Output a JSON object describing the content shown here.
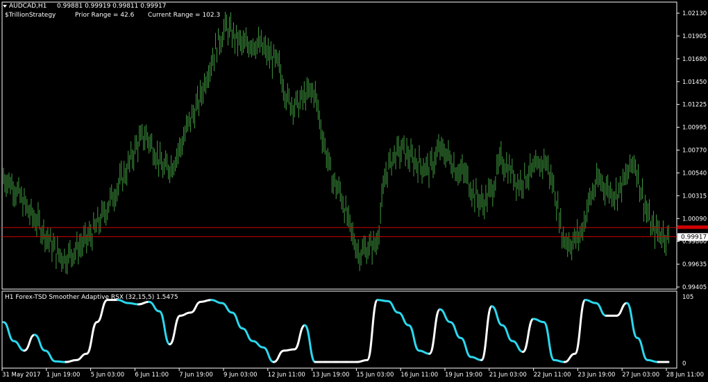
{
  "header": {
    "symbol": "AUDCAD,H1",
    "ohlc": "0.99881 0.99919 0.99811 0.99917",
    "indicator_name": "$TrillionStrategy",
    "prior_range": "Prior Range = 42.6",
    "current_range": "Current Range = 102.3"
  },
  "subwindow": {
    "title": "H1 Forex-TSD Smoother Adaptive RSX (32,15,5) 1.5475",
    "scale_labels": [
      "105",
      "0"
    ],
    "scale_values": [
      105,
      0
    ]
  },
  "price_scale": {
    "labels": [
      "1.02130",
      "1.01905",
      "1.01680",
      "1.01450",
      "1.01225",
      "1.00995",
      "1.00770",
      "1.00540",
      "1.00315",
      "1.00090",
      "0.99860",
      "0.99635",
      "0.99405"
    ],
    "current_price_label": "0.99917",
    "current_price": 0.99917,
    "red_line_price": 1.0001
  },
  "time_axis": {
    "labels": [
      "31 May 2017",
      "1 Jun 19:00",
      "5 Jun 03:00",
      "6 Jun 11:00",
      "7 Jun 19:00",
      "9 Jun 03:00",
      "12 Jun 11:00",
      "13 Jun 19:00",
      "15 Jun 03:00",
      "16 Jun 11:00",
      "19 Jun 19:00",
      "21 Jun 03:00",
      "22 Jun 11:00",
      "23 Jun 19:00",
      "27 Jun 03:00",
      "28 Jun 11:00"
    ]
  },
  "colors": {
    "background": "#000000",
    "candles": "#3f9a3f",
    "grid_border": "#ffffff",
    "red_line": "#d00000",
    "rsx_up": "#ffffff",
    "rsx_down": "#2ad8ee",
    "price_tag_bg": "#ffffff"
  },
  "chart_data": {
    "type": "line",
    "main_window": {
      "kind": "price bars",
      "ylim": [
        0.99405,
        1.0219
      ],
      "close_path": [
        [
          0,
          1.0052
        ],
        [
          5,
          1.0045
        ],
        [
          10,
          1.003
        ],
        [
          15,
          1.0015
        ],
        [
          20,
          1.0005
        ],
        [
          25,
          0.999
        ],
        [
          30,
          0.9975
        ],
        [
          35,
          0.997
        ],
        [
          40,
          0.9978
        ],
        [
          45,
          0.9985
        ],
        [
          50,
          0.9995
        ],
        [
          55,
          1.001
        ],
        [
          60,
          1.0028
        ],
        [
          65,
          1.0045
        ],
        [
          70,
          1.0062
        ],
        [
          75,
          1.0085
        ],
        [
          80,
          1.0095
        ],
        [
          85,
          1.008
        ],
        [
          90,
          1.006
        ],
        [
          95,
          1.0065
        ],
        [
          100,
          1.0085
        ],
        [
          105,
          1.011
        ],
        [
          110,
          1.0128
        ],
        [
          115,
          1.016
        ],
        [
          120,
          1.0185
        ],
        [
          125,
          1.0205
        ],
        [
          130,
          1.0195
        ],
        [
          135,
          1.0185
        ],
        [
          140,
          1.019
        ],
        [
          145,
          1.0185
        ],
        [
          150,
          1.0175
        ],
        [
          155,
          1.0165
        ],
        [
          160,
          1.013
        ],
        [
          165,
          1.0125
        ],
        [
          170,
          1.0135
        ],
        [
          175,
          1.014
        ],
        [
          180,
          1.009
        ],
        [
          185,
          1.005
        ],
        [
          190,
          1.0035
        ],
        [
          195,
          1.0
        ],
        [
          200,
          0.9975
        ],
        [
          205,
          0.998
        ],
        [
          210,
          0.9985
        ],
        [
          215,
          1.0055
        ],
        [
          220,
          1.0075
        ],
        [
          225,
          1.008
        ],
        [
          230,
          1.007
        ],
        [
          235,
          1.0065
        ],
        [
          240,
          1.006
        ],
        [
          245,
          1.008
        ],
        [
          250,
          1.0075
        ],
        [
          255,
          1.006
        ],
        [
          260,
          1.0055
        ],
        [
          265,
          1.0035
        ],
        [
          270,
          1.0025
        ],
        [
          275,
          1.004
        ],
        [
          280,
          1.007
        ],
        [
          285,
          1.006
        ],
        [
          290,
          1.0045
        ],
        [
          295,
          1.0055
        ],
        [
          300,
          1.006
        ],
        [
          305,
          1.007
        ],
        [
          310,
          1.004
        ],
        [
          315,
          0.999
        ],
        [
          320,
          0.9985
        ],
        [
          325,
          0.9995
        ],
        [
          330,
          1.003
        ],
        [
          335,
          1.005
        ],
        [
          340,
          1.004
        ],
        [
          345,
          1.0035
        ],
        [
          350,
          1.005
        ],
        [
          355,
          1.007
        ],
        [
          360,
          1.003
        ],
        [
          365,
          1.0
        ],
        [
          370,
          0.9995
        ],
        [
          375,
          0.999
        ]
      ]
    },
    "indicator": {
      "name": "Forex-TSD Smoother Adaptive RSX (32,15,5)",
      "value": 1.5475,
      "ylim": [
        0,
        105
      ],
      "series": [
        [
          0,
          65
        ],
        [
          5,
          35
        ],
        [
          10,
          20
        ],
        [
          15,
          45
        ],
        [
          20,
          20
        ],
        [
          25,
          3
        ],
        [
          30,
          2
        ],
        [
          35,
          5
        ],
        [
          40,
          15
        ],
        [
          45,
          65
        ],
        [
          50,
          100
        ],
        [
          55,
          100
        ],
        [
          60,
          95
        ],
        [
          65,
          93
        ],
        [
          70,
          97
        ],
        [
          75,
          82
        ],
        [
          80,
          30
        ],
        [
          85,
          75
        ],
        [
          90,
          80
        ],
        [
          95,
          97
        ],
        [
          100,
          100
        ],
        [
          105,
          95
        ],
        [
          110,
          80
        ],
        [
          115,
          55
        ],
        [
          120,
          35
        ],
        [
          125,
          25
        ],
        [
          130,
          2
        ],
        [
          135,
          20
        ],
        [
          140,
          22
        ],
        [
          145,
          60
        ],
        [
          150,
          2
        ],
        [
          155,
          2
        ],
        [
          160,
          2
        ],
        [
          165,
          2
        ],
        [
          170,
          2
        ],
        [
          175,
          5
        ],
        [
          180,
          100
        ],
        [
          185,
          98
        ],
        [
          190,
          80
        ],
        [
          195,
          60
        ],
        [
          200,
          20
        ],
        [
          205,
          15
        ],
        [
          210,
          85
        ],
        [
          215,
          65
        ],
        [
          220,
          40
        ],
        [
          225,
          10
        ],
        [
          230,
          5
        ],
        [
          235,
          90
        ],
        [
          240,
          60
        ],
        [
          245,
          35
        ],
        [
          250,
          18
        ],
        [
          255,
          70
        ],
        [
          260,
          65
        ],
        [
          265,
          5
        ],
        [
          270,
          2
        ],
        [
          275,
          15
        ],
        [
          280,
          100
        ],
        [
          285,
          95
        ],
        [
          290,
          75
        ],
        [
          295,
          75
        ],
        [
          300,
          95
        ],
        [
          305,
          40
        ],
        [
          310,
          5
        ],
        [
          315,
          2
        ],
        [
          320,
          2
        ]
      ]
    }
  }
}
